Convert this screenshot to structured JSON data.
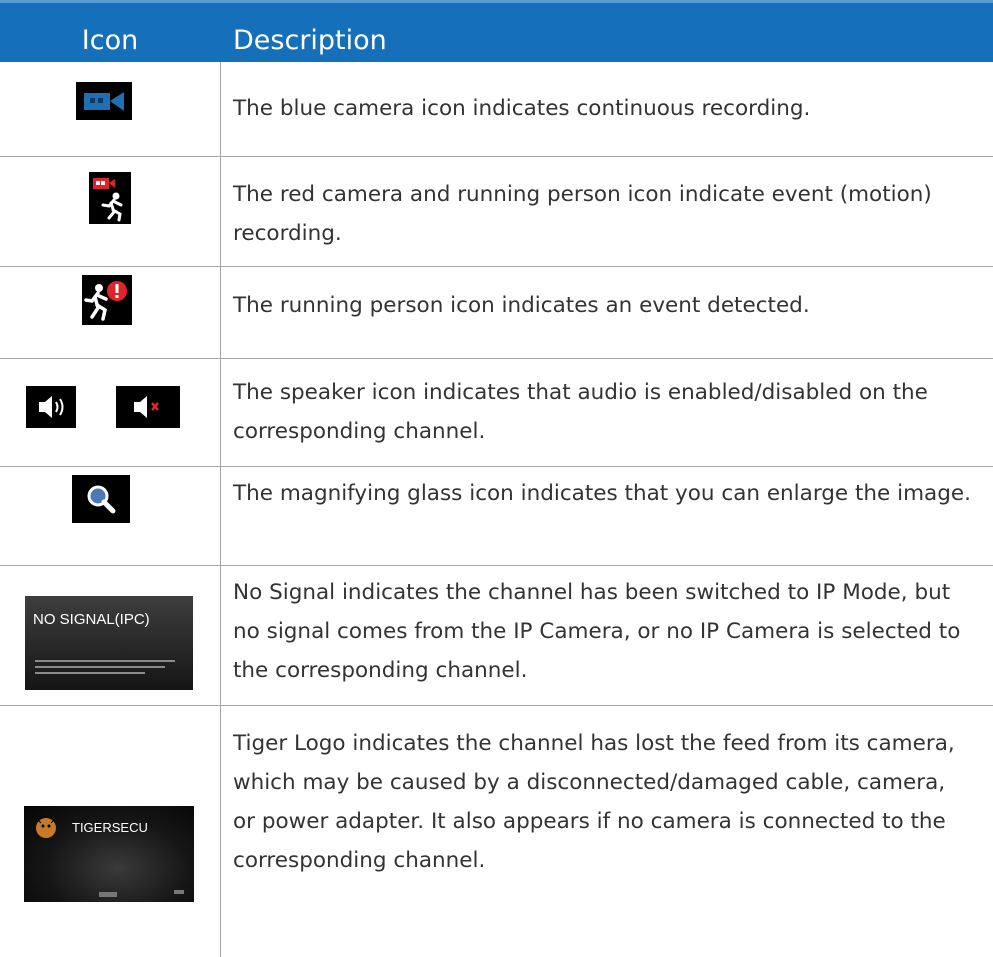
{
  "header": {
    "icon_col": "Icon",
    "desc_col": "Description"
  },
  "rows": [
    {
      "icon": "blue-camera-icon",
      "description": "The blue camera icon indicates continuous recording."
    },
    {
      "icon": "red-camera-running-person-icon",
      "description": "The red camera and running person icon indicate event (motion) recording."
    },
    {
      "icon": "running-person-alert-icon",
      "description": "The running person icon indicates an event detected."
    },
    {
      "icon": "speaker-icon",
      "description": "The speaker icon indicates that audio is enabled/disabled on the corresponding channel."
    },
    {
      "icon": "magnifying-glass-icon",
      "description": "The magnifying glass icon indicates that you can enlarge the image."
    },
    {
      "icon": "no-signal-thumbnail",
      "thumbnail_title": "NO SIGNAL(IPC)",
      "description": "No Signal indicates the channel has been switched to IP Mode, but no signal comes from the IP Camera, or no IP Camera is selected to the corresponding channel."
    },
    {
      "icon": "tiger-logo-thumbnail",
      "thumbnail_title": "TIGERSECU",
      "description": "Tiger Logo indicates the channel has lost the feed from its camera, which may be caused by a disconnected/damaged cable, camera, or power adapter. It also appears if no camera is connected to the corresponding channel."
    }
  ],
  "colors": {
    "header_bg": "#1670b9",
    "header_text": "#ffffff",
    "body_text": "#333333",
    "rule": "#a6a6a6",
    "camera_blue": "#1f6fb5",
    "alert_red": "#e0242b"
  }
}
